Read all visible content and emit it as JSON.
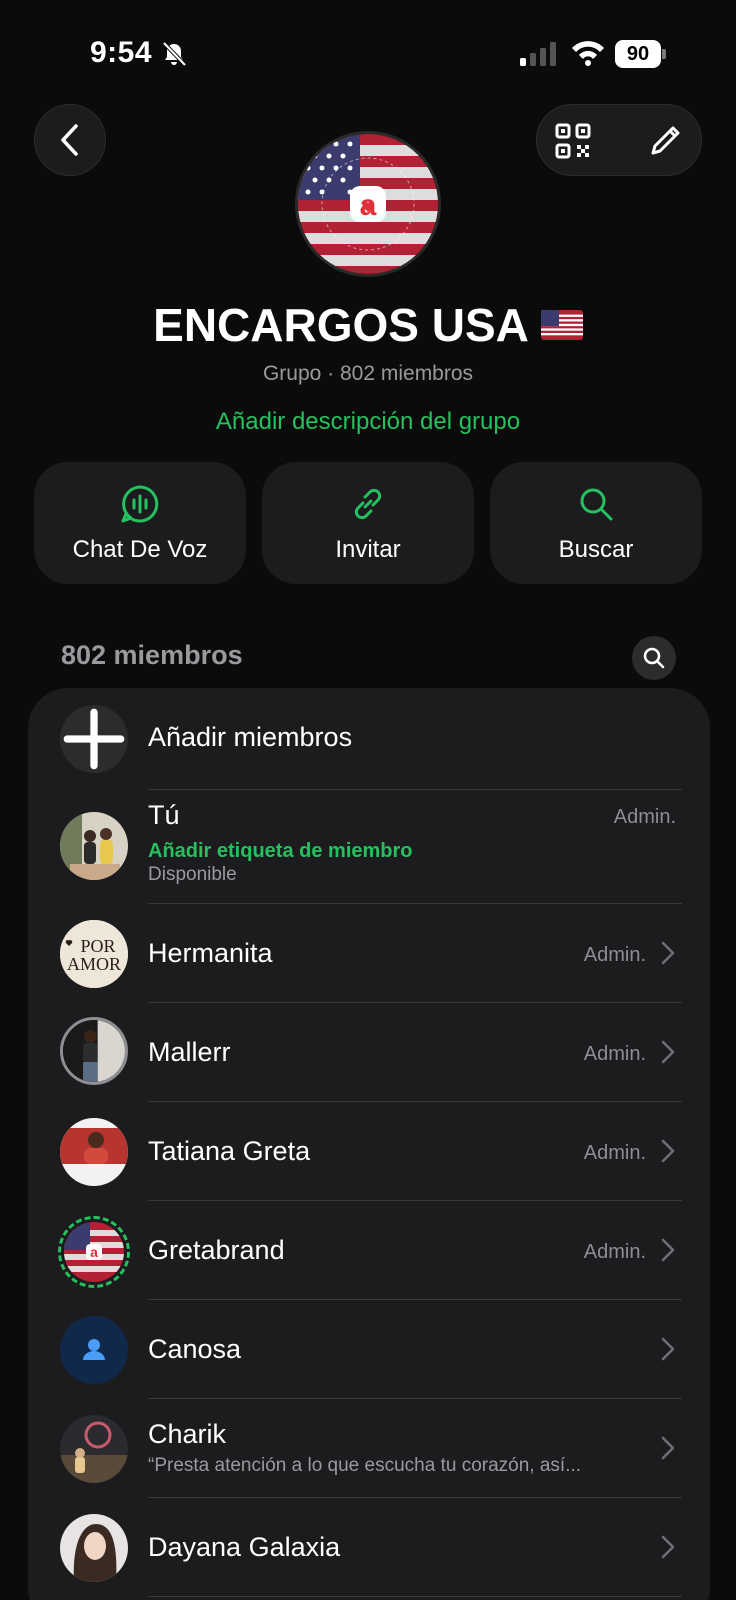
{
  "status_bar": {
    "time": "9:54",
    "battery": "90"
  },
  "group": {
    "name": "ENCARGOS USA",
    "subtitle": "Grupo · 802 miembros",
    "add_description": "Añadir descripción del grupo"
  },
  "actions": [
    {
      "label": "Chat De Voz",
      "icon": "voice-chat-icon"
    },
    {
      "label": "Invitar",
      "icon": "link-icon"
    },
    {
      "label": "Buscar",
      "icon": "search-icon"
    }
  ],
  "members": {
    "count_label": "802 miembros",
    "add_label": "Añadir miembros",
    "list": [
      {
        "name": "Tú",
        "role": "Admin.",
        "tag": "Añadir etiqueta de miembro",
        "status": "Disponible"
      },
      {
        "name": "Hermanita",
        "role": "Admin.",
        "avatar_text_1": "POR",
        "avatar_text_2": "AMOR"
      },
      {
        "name": "Mallerr",
        "role": "Admin."
      },
      {
        "name": "Tatiana Greta",
        "role": "Admin."
      },
      {
        "name": "Gretabrand",
        "role": "Admin."
      },
      {
        "name": "Canosa",
        "role": ""
      },
      {
        "name": "Charik",
        "role": "",
        "status": "“Presta atención a lo que escucha tu corazón, así..."
      },
      {
        "name": "Dayana Galaxia",
        "role": ""
      }
    ]
  },
  "colors": {
    "accent": "#25c15e",
    "card": "#1c1c1e",
    "background": "#0b0b0b"
  }
}
